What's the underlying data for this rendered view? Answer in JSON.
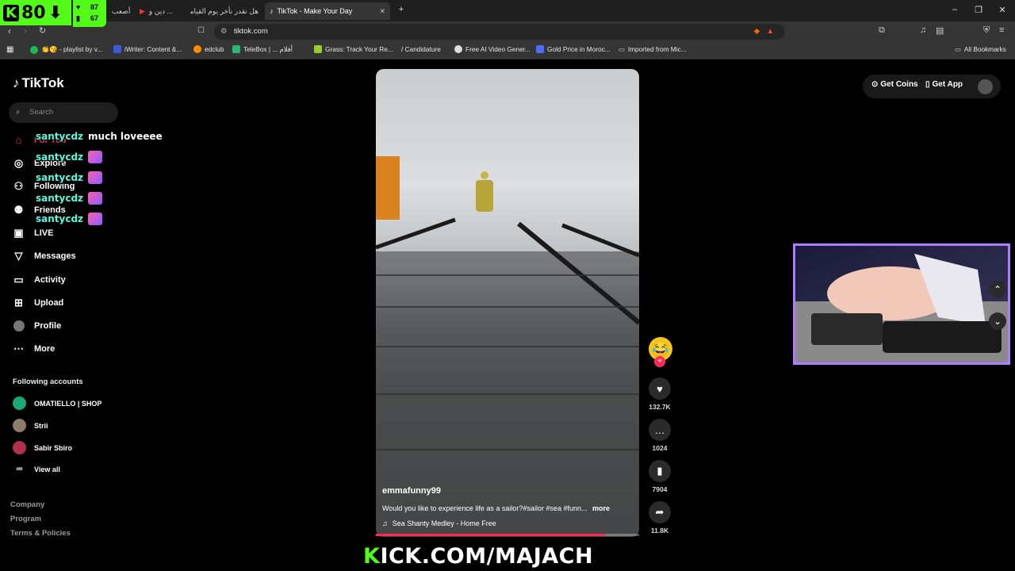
{
  "overlay": {
    "kick_count": "80",
    "viewer_top": "87",
    "viewer_bottom": "67",
    "footer_prefix": "K",
    "footer_text": "ICK.COM/MAJACH"
  },
  "browser": {
    "tabs": [
      {
        "label": "أصعب"
      },
      {
        "label": "دين و ..."
      },
      {
        "label": "هل نقدر نأخر يوم القيامة ؟ ..."
      },
      {
        "label": "TikTok - Make Your Day"
      }
    ],
    "url": "tiktok.com",
    "bookmarks": [
      {
        "label": "👏😘 - playlist by v...",
        "color": "#1db954"
      },
      {
        "label": "iWriter: Content &...",
        "color": "#3b5bdb"
      },
      {
        "label": "edclub",
        "color": "#ff8c00"
      },
      {
        "label": "TeleBox | ... أفلام",
        "color": "#2bb673"
      },
      {
        "label": "Grass: Track Your Re...",
        "color": "#9acd32"
      },
      {
        "label": "/ Candidature",
        "color": "#353535"
      },
      {
        "label": "Free AI Video Gener...",
        "color": "#dddddd"
      },
      {
        "label": "Gold Price in Moroc...",
        "color": "#4a6cf7"
      },
      {
        "label": "Imported from Mic...",
        "color": "#353535"
      }
    ],
    "all_bookmarks": "All Bookmarks"
  },
  "sidebar": {
    "logo": "TikTok",
    "search_placeholder": "Search",
    "nav": [
      {
        "label": "For You",
        "icon": "home-icon"
      },
      {
        "label": "Explore",
        "icon": "compass-icon"
      },
      {
        "label": "Following",
        "icon": "user-plus-icon"
      },
      {
        "label": "Friends",
        "icon": "friends-icon"
      },
      {
        "label": "LIVE",
        "icon": "live-icon"
      },
      {
        "label": "Messages",
        "icon": "send-icon"
      },
      {
        "label": "Activity",
        "icon": "activity-icon"
      },
      {
        "label": "Upload",
        "icon": "plus-square-icon"
      },
      {
        "label": "Profile",
        "icon": "avatar"
      },
      {
        "label": "More",
        "icon": "more-icon"
      }
    ],
    "following_title": "Following accounts",
    "accounts": [
      {
        "name": "OMATIELLO | SHOP",
        "color": "#1aa873"
      },
      {
        "name": "Strii",
        "color": "#8d7b6b"
      },
      {
        "name": "Sabir Sbiro",
        "color": "#b03050"
      }
    ],
    "view_all": "View all",
    "footer": [
      "Company",
      "Program",
      "Terms & Policies"
    ]
  },
  "chat": [
    {
      "user": "santycdz",
      "message": "much loveeee"
    },
    {
      "user": "santycdz",
      "message": ""
    },
    {
      "user": "santycdz",
      "message": ""
    },
    {
      "user": "santycdz",
      "message": ""
    },
    {
      "user": "santycdz",
      "message": ""
    }
  ],
  "video": {
    "username": "emmafunny99",
    "description": "Would you like to experience life as a sailor?#sailor #sea #funn...",
    "more_label": "more",
    "music": "Sea Shanty Medley - Home Free",
    "progress": 0.87
  },
  "actions": {
    "likes": "132.7K",
    "comments": "1024",
    "saves": "7904",
    "shares": "11.8K"
  },
  "topbar": {
    "get_coins": "Get Coins",
    "get_app": "Get App"
  },
  "colors": {
    "accent": "#fe2c55",
    "kick_green": "#53fc18"
  }
}
